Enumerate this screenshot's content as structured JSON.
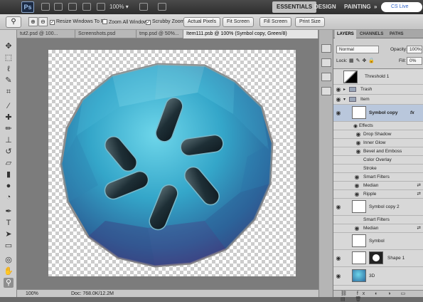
{
  "app": {
    "logo": "Ps",
    "zoom": "100%",
    "zoom_arrow": "▾"
  },
  "workspaces": {
    "essentials": "ESSENTIALS",
    "design": "DESIGN",
    "painting": "PAINTING",
    "overflow": "»",
    "live": "CS Live"
  },
  "options": {
    "resize_windows": "Resize Windows To Fit",
    "zoom_all": "Zoom All Windows",
    "scrubby_zoom": "Scrubby Zoom",
    "actual_pixels": "Actual Pixels",
    "fit_screen": "Fit Screen",
    "fill_screen": "Fill Screen",
    "print_size": "Print Size",
    "resize_checked": "✓",
    "scrubby_checked": "✓"
  },
  "doc_tabs": [
    {
      "label": "tut2.psd @ 100..."
    },
    {
      "label": "Screenshots.psd"
    },
    {
      "label": "tmp.psd @ 50%..."
    },
    {
      "label": "Item111.psb @ 100% (Symbol copy, Green/8)"
    }
  ],
  "status": {
    "zoom": "100%",
    "doc": "Doc: 768.0K/12.2M"
  },
  "panel": {
    "tabs": {
      "layers": "LAYERS",
      "channels": "CHANNELS",
      "paths": "PATHS"
    },
    "blend_mode": "Normal",
    "opacity_label": "Opacity:",
    "opacity_value": "100%",
    "lock_label": "Lock:",
    "fill_label": "Fill:",
    "fill_value": "0%",
    "layers": {
      "threshold": "Threshold 1",
      "trash": "Trash",
      "item": "Item",
      "symbol_copy": "Symbol copy",
      "effects": "Effects",
      "drop_shadow": "Drop Shadow",
      "inner_glow": "Inner Glow",
      "bevel_emboss": "Bevel and Emboss",
      "color_overlay": "Color Overlay",
      "stroke": "Stroke",
      "smart_filters": "Smart Filters",
      "median": "Median",
      "ripple": "Ripple",
      "symbol_copy2": "Symbol copy 2",
      "smart_filters2": "Smart Filters",
      "median2": "Median",
      "symbol": "Symbol",
      "shape1": "Shape 1",
      "three_d": "3D"
    },
    "fx": "fx",
    "footer_icons": "⛓ fx ◐ ◑ ▭ ▤ 🗑"
  },
  "colors": {
    "accent": "#3399cc",
    "ball_light": "#4cc2dd",
    "ball_dark": "#2d4d86"
  }
}
